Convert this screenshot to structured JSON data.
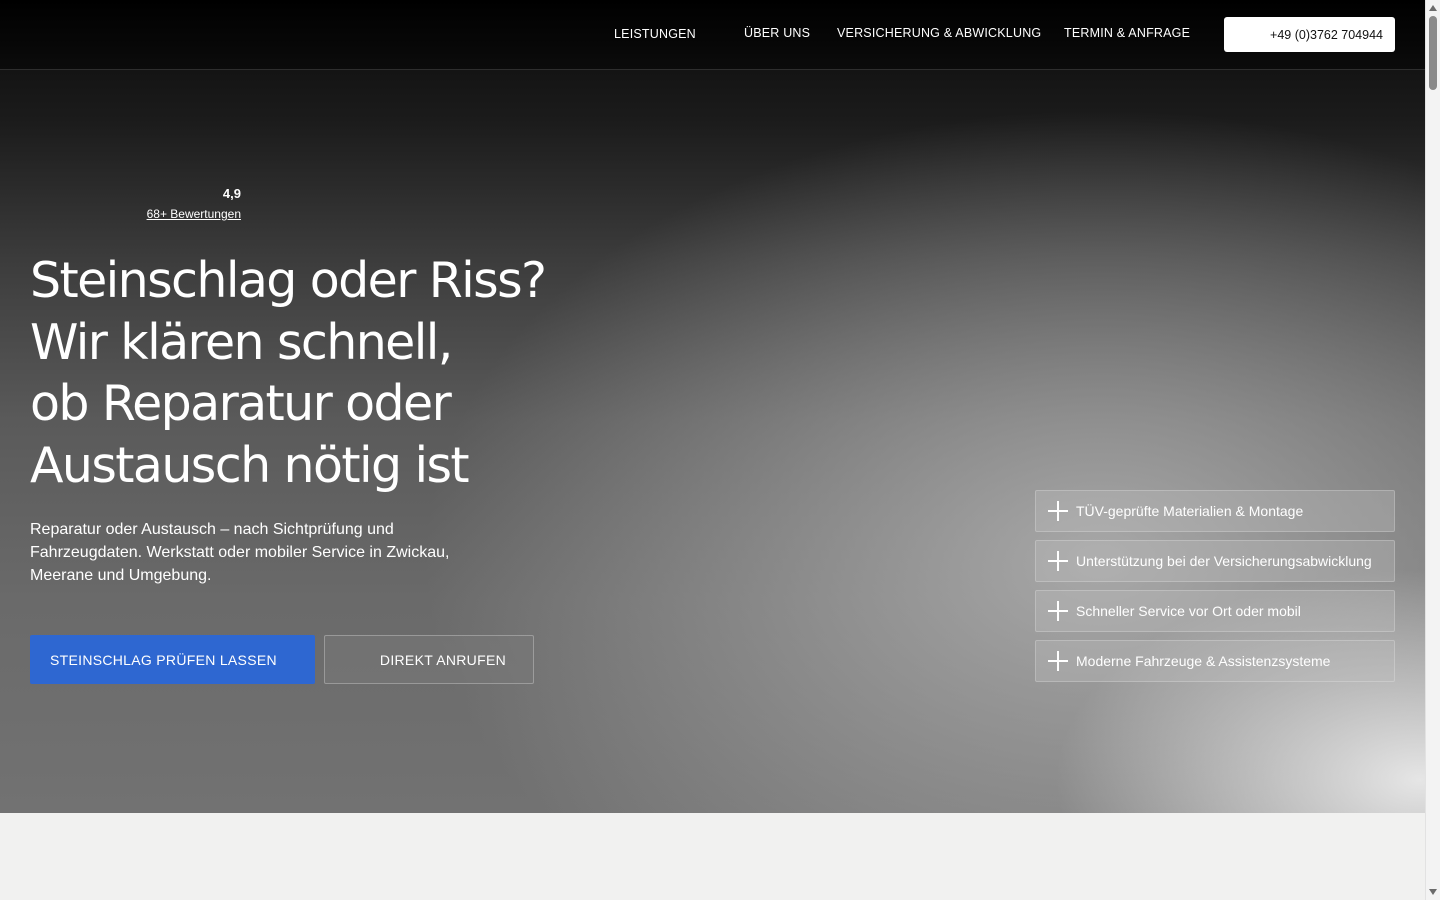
{
  "nav": {
    "items": [
      {
        "label": "LEISTUNGEN"
      },
      {
        "label": "ÜBER UNS"
      },
      {
        "label": "VERSICHERUNG & ABWICKLUNG"
      },
      {
        "label": "TERMIN & ANFRAGE"
      }
    ],
    "phone_label": "+49 (0)3762 704944"
  },
  "hero": {
    "rating": {
      "score": "4,9",
      "count_label": "68+ Bewertungen"
    },
    "headline_lines": [
      "Steinschlag oder Riss?",
      "Wir klären schnell,",
      "ob Reparatur oder",
      "Austausch nötig ist"
    ],
    "subtext": "Reparatur oder Austausch – nach Sichtprüfung und Fahrzeugdaten. Werkstatt oder mobiler Service in Zwickau, Meerane und Umgebung.",
    "cta_primary": "STEINSCHLAG PRÜFEN LASSEN",
    "cta_secondary": "DIREKT ANRUFEN",
    "features": [
      {
        "label": "TÜV-geprüfte Materialien & Montage",
        "icon": "plus-icon"
      },
      {
        "label": "Unterstützung bei der Versicherungsabwicklung",
        "icon": "plus-icon"
      },
      {
        "label": "Schneller Service vor Ort oder mobil",
        "icon": "plus-icon"
      },
      {
        "label": "Moderne Fahrzeuge & Assistenzsysteme",
        "icon": "plus-icon"
      }
    ]
  },
  "colors": {
    "accent": "#2e67d1",
    "header_bg": "#000000",
    "section_bg": "#f1f1f0"
  }
}
